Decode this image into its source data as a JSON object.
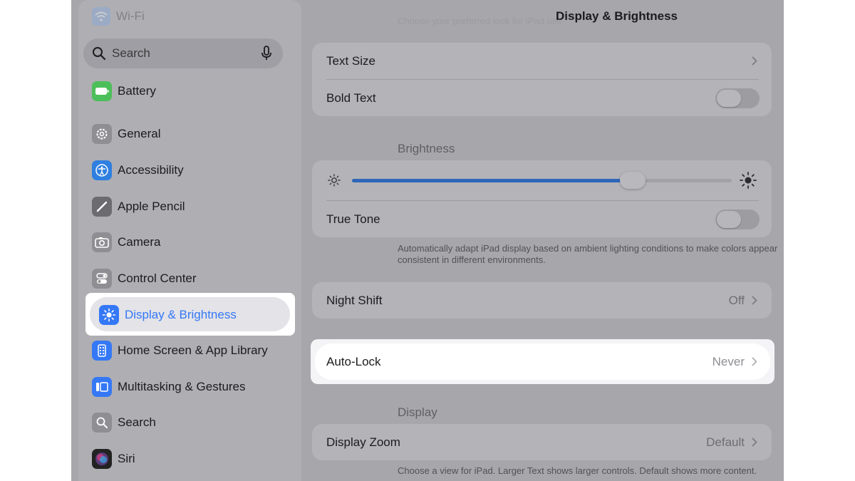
{
  "sidebar": {
    "faded_item": "Wi-Fi",
    "search_placeholder": "Search",
    "items": [
      {
        "label": "Battery",
        "icon": "battery-icon",
        "color": "#4cbf5a"
      },
      {
        "label": "General",
        "icon": "gear-icon",
        "color": "#8e8e93"
      },
      {
        "label": "Accessibility",
        "icon": "accessibility-icon",
        "color": "#2f7fe0"
      },
      {
        "label": "Apple Pencil",
        "icon": "pencil-icon",
        "color": "#6b6b70"
      },
      {
        "label": "Camera",
        "icon": "camera-icon",
        "color": "#8e8e93"
      },
      {
        "label": "Control Center",
        "icon": "toggles-icon",
        "color": "#8e8e93"
      },
      {
        "label": "Display & Brightness",
        "icon": "sun-icon",
        "color": "#3478f6",
        "selected": true
      },
      {
        "label": "Home Screen & App Library",
        "icon": "home-screen-icon",
        "color": "#3478f6"
      },
      {
        "label": "Multitasking & Gestures",
        "icon": "multitasking-icon",
        "color": "#3478f6"
      },
      {
        "label": "Search",
        "icon": "search-icon",
        "color": "#8e8e93"
      },
      {
        "label": "Siri",
        "icon": "siri-icon",
        "color": "#222222"
      }
    ]
  },
  "main": {
    "title": "Display & Brightness",
    "ghost_text": "Choose your preferred look for iPad use",
    "text_group": {
      "text_size": "Text Size",
      "bold_text": "Bold Text",
      "bold_text_on": false
    },
    "brightness": {
      "header": "Brightness",
      "level_fraction": 0.74,
      "true_tone": "True Tone",
      "true_tone_on": false,
      "footnote": "Automatically adapt iPad display based on ambient lighting conditions to make colors appear consistent in different environments."
    },
    "night_shift": {
      "label": "Night Shift",
      "value": "Off"
    },
    "auto_lock": {
      "label": "Auto-Lock",
      "value": "Never"
    },
    "display": {
      "header": "Display",
      "zoom_label": "Display Zoom",
      "zoom_value": "Default",
      "footnote": "Choose a view for iPad. Larger Text shows larger controls. Default shows more content."
    }
  },
  "colors": {
    "accent": "#3478f6",
    "slider_fill": "#2f66b8"
  }
}
